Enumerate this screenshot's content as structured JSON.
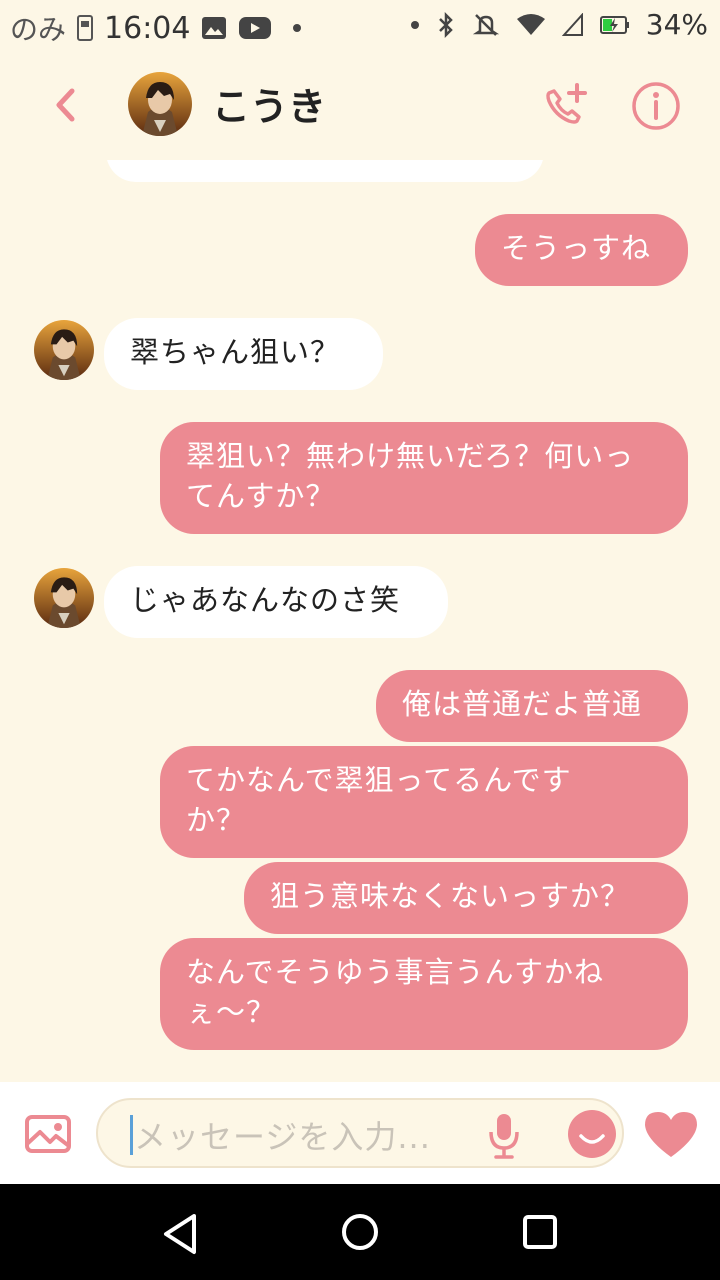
{
  "status_bar": {
    "carrier": "のみ",
    "time": "16:04",
    "battery": "34%",
    "icons": [
      "sim-icon",
      "gallery-icon",
      "youtube-icon",
      "dot-icon",
      "bluetooth-icon",
      "mute-icon",
      "wifi-icon",
      "signal-icon",
      "battery-charging-icon"
    ]
  },
  "header": {
    "contact_name": "こうき"
  },
  "messages": [
    {
      "side": "out",
      "text": "そうっすね"
    },
    {
      "side": "in",
      "text": "翠ちゃん狙い？"
    },
    {
      "side": "out",
      "text": "翠狙い？無わけ無いだろ？何いってんすか？"
    },
    {
      "side": "in",
      "text": "じゃあなんなのさ笑"
    },
    {
      "side": "out",
      "text": "俺は普通だよ普通"
    },
    {
      "side": "out",
      "text": "てかなんで翠狙ってるんですか？"
    },
    {
      "side": "out",
      "text": "狙う意味なくないっすか？"
    },
    {
      "side": "out",
      "text": "なんでそうゆう事言うんすかねぇ〜？"
    }
  ],
  "input": {
    "placeholder": "メッセージを入力..."
  },
  "colors": {
    "accent": "#ec8a92",
    "background": "#fdf7e6",
    "incoming_bubble": "#ffffff"
  }
}
